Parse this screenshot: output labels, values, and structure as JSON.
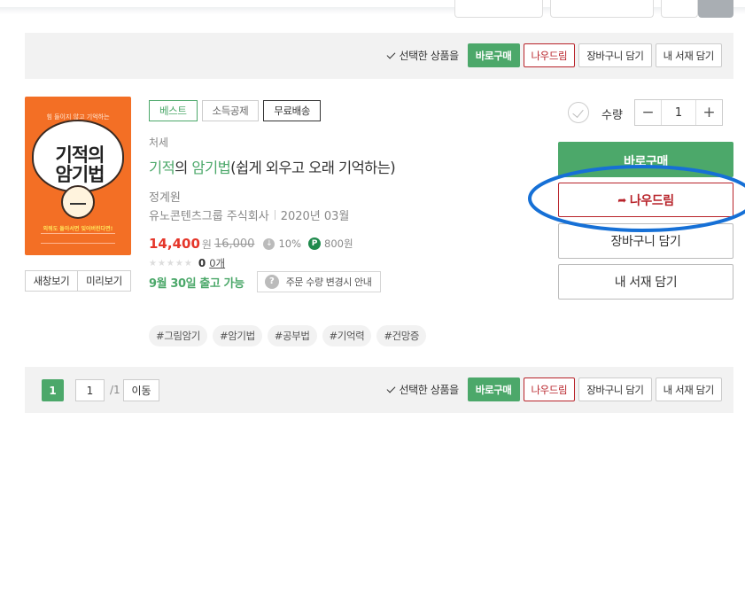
{
  "top_fragments": [
    "",
    "",
    ""
  ],
  "action_bar": {
    "select_label": "선택한 상품을",
    "buy_now": "바로구매",
    "gift": "나우드림",
    "cart": "장바구니 담기",
    "shelf": "내 서재 담기"
  },
  "book": {
    "cover": {
      "top_text": "힘 들이지 않고 기억하는",
      "title_line1": "기적의",
      "title_line2": "암기법",
      "band_text": "외워도 돌아서면 잊어버린다면!"
    },
    "badges": [
      "베스트",
      "소득공제",
      "무료배송"
    ],
    "category": "처세",
    "title_highlight1": "기적",
    "title_part1": "의 ",
    "title_highlight2": "암기법",
    "title_part2": "(쉽게 외우고 오래 기억하는)",
    "author": "정계원",
    "publisher": "유노콘텐츠그룹 주식회사",
    "pub_date": "2020년 03월",
    "price": "14,400",
    "price_unit": "원",
    "original_price": "16,000",
    "discount": "10%",
    "points": "800원",
    "stars": "★★★★★",
    "rating": "0",
    "review_count": "0개",
    "ship_date": "9월 30일 출고 가능",
    "order_notice": "주문 수량 변경시 안내",
    "hashtags": [
      "#그림암기",
      "#암기법",
      "#공부법",
      "#기억력",
      "#건망증"
    ],
    "new_window": "새창보기",
    "preview": "미리보기"
  },
  "purchase": {
    "qty_label": "수량",
    "qty_value": "1",
    "minus": "−",
    "plus": "+",
    "buy_now": "바로구매",
    "gift": "나우드림",
    "cart": "장바구니 담기",
    "shelf": "내 서재 담기"
  },
  "pagination": {
    "current": "1",
    "input_value": "1",
    "total": "/1",
    "go": "이동"
  },
  "colors": {
    "accent_green": "#4ca86a",
    "price_red": "#e5362a",
    "gift_red": "#b8232a",
    "annotation_blue": "#1670d6",
    "bar_bg": "#f2f2f2"
  }
}
